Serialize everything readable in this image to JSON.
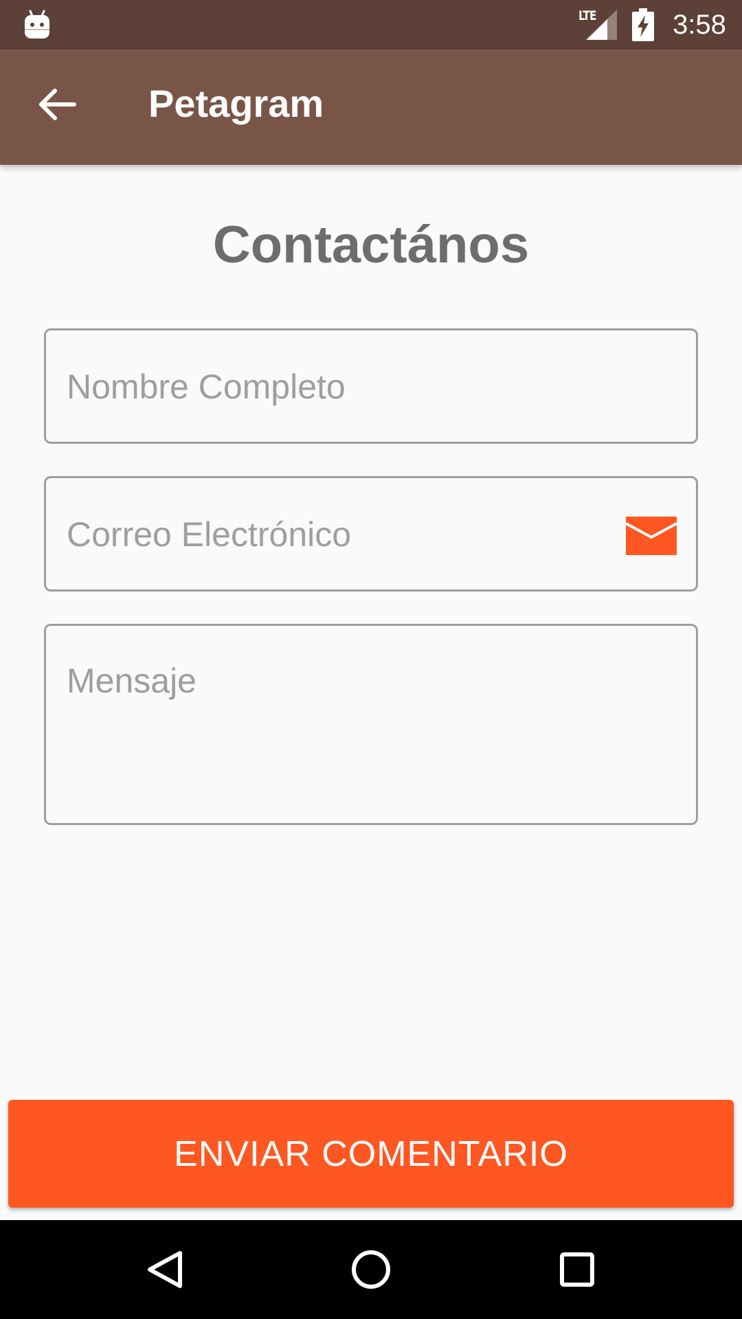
{
  "status_bar": {
    "network_label": "LTE",
    "time": "3:58",
    "icons": [
      "android-icon",
      "signal-icon",
      "battery-charging-icon"
    ]
  },
  "app_bar": {
    "title": "Petagram",
    "back_icon": "arrow-left-icon"
  },
  "page": {
    "heading": "Contactános"
  },
  "form": {
    "name": {
      "placeholder": "Nombre Completo",
      "value": ""
    },
    "email": {
      "placeholder": "Correo Electrónico",
      "value": "",
      "icon": "envelope-icon"
    },
    "message": {
      "placeholder": "Mensaje",
      "value": ""
    },
    "submit_label": "ENVIAR COMENTARIO"
  },
  "navigation_bar": {
    "icons": [
      "nav-back-icon",
      "nav-home-icon",
      "nav-recents-icon"
    ]
  },
  "colors": {
    "status_bar": "#5d4037",
    "app_bar": "#795548",
    "accent": "#ff5722",
    "background": "#fafafa",
    "heading_text": "#6d6d6d",
    "field_border": "#9e9e9e",
    "placeholder_text": "#9e9e9e"
  }
}
